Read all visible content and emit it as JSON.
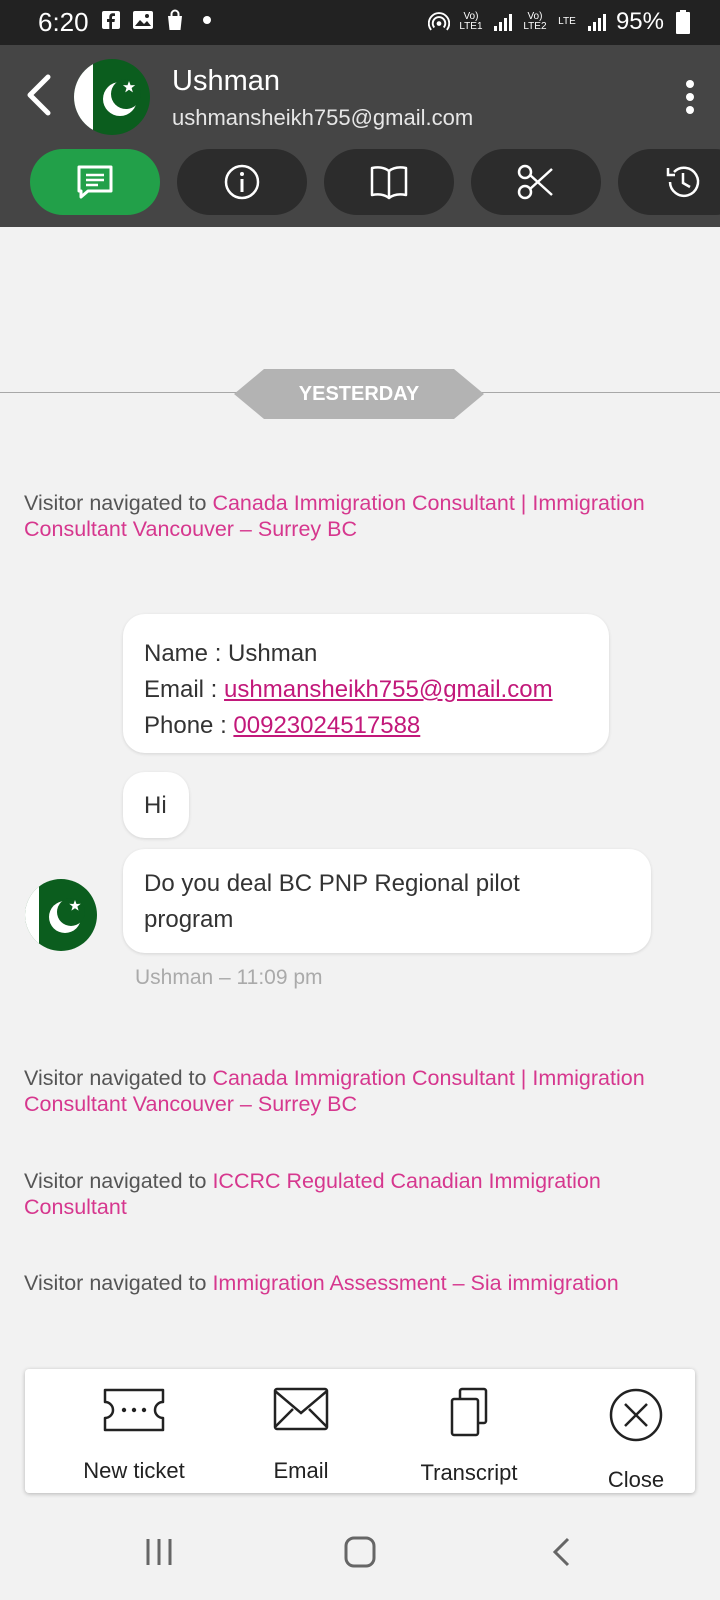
{
  "status_bar": {
    "time": "6:20",
    "battery": "95%",
    "lte1": "Vo) LTE1",
    "lte2": "Vo) LTE2",
    "lte": "LTE"
  },
  "header": {
    "contact_name": "Ushman",
    "contact_email": "ushmansheikh755@gmail.com"
  },
  "tabs": [
    {
      "icon": "chat-icon",
      "active": true
    },
    {
      "icon": "info-icon",
      "active": false
    },
    {
      "icon": "book-icon",
      "active": false
    },
    {
      "icon": "scissors-icon",
      "active": false
    },
    {
      "icon": "history-icon",
      "active": false
    }
  ],
  "chat": {
    "day_separator": "YESTERDAY",
    "visitor_prefix": "Visitor navigated to",
    "nav_events": [
      {
        "link": "Canada Immigration Consultant | Immigration Consultant Vancouver – Surrey BC"
      },
      {
        "link": "Canada Immigration Consultant | Immigration Consultant Vancouver – Surrey BC"
      },
      {
        "link": "ICCRC Regulated Canadian Immigration Consultant"
      },
      {
        "link": "Immigration Assessment – Sia immigration"
      }
    ],
    "info_card": {
      "name_label": "Name :",
      "name_value": "Ushman",
      "email_label": "Email :",
      "email_value": "ushmansheikh755@gmail.com",
      "phone_label": "Phone :",
      "phone_value": "00923024517588"
    },
    "messages": [
      "Hi",
      "Do you deal BC PNP Regional pilot program"
    ],
    "message_meta": "Ushman – 11:09 pm"
  },
  "actions": {
    "new_ticket": "New ticket",
    "email": "Email",
    "transcript": "Transcript",
    "close": "Close"
  },
  "colors": {
    "header": "#454545",
    "active_tab": "#22a049",
    "link": "#d6378e",
    "status_bar": "#222222"
  }
}
